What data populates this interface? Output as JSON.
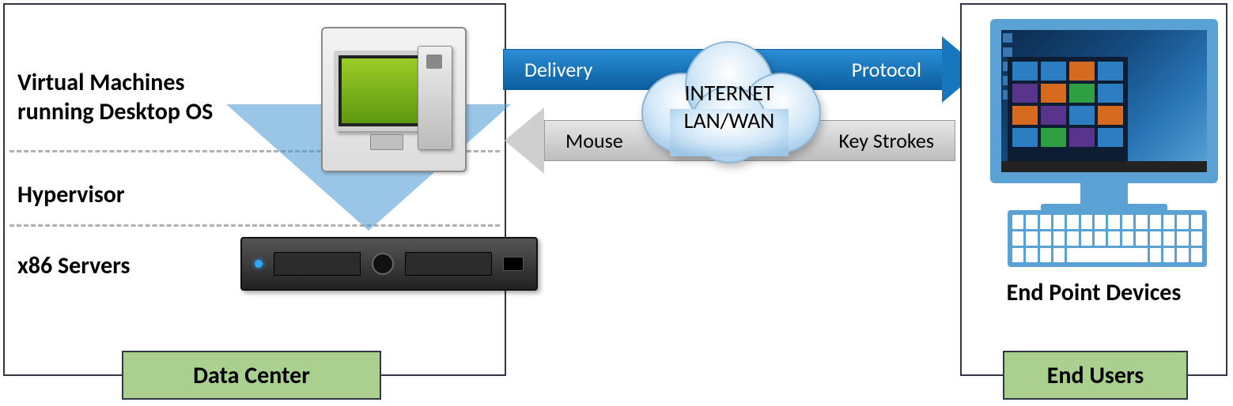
{
  "data_center": {
    "box_label": "Data Center",
    "layers": {
      "vm": "Virtual Machines\nrunning Desktop OS",
      "hypervisor": "Hypervisor",
      "servers": "x86 Servers"
    }
  },
  "network": {
    "top_arrow_left": "Delivery",
    "top_arrow_right": "Protocol",
    "bottom_arrow_left": "Mouse",
    "bottom_arrow_right": "Key Strokes",
    "cloud_line1": "INTERNET",
    "cloud_line2": "LAN/WAN"
  },
  "end_users": {
    "box_label": "End Users",
    "device_label": "End Point Devices"
  }
}
